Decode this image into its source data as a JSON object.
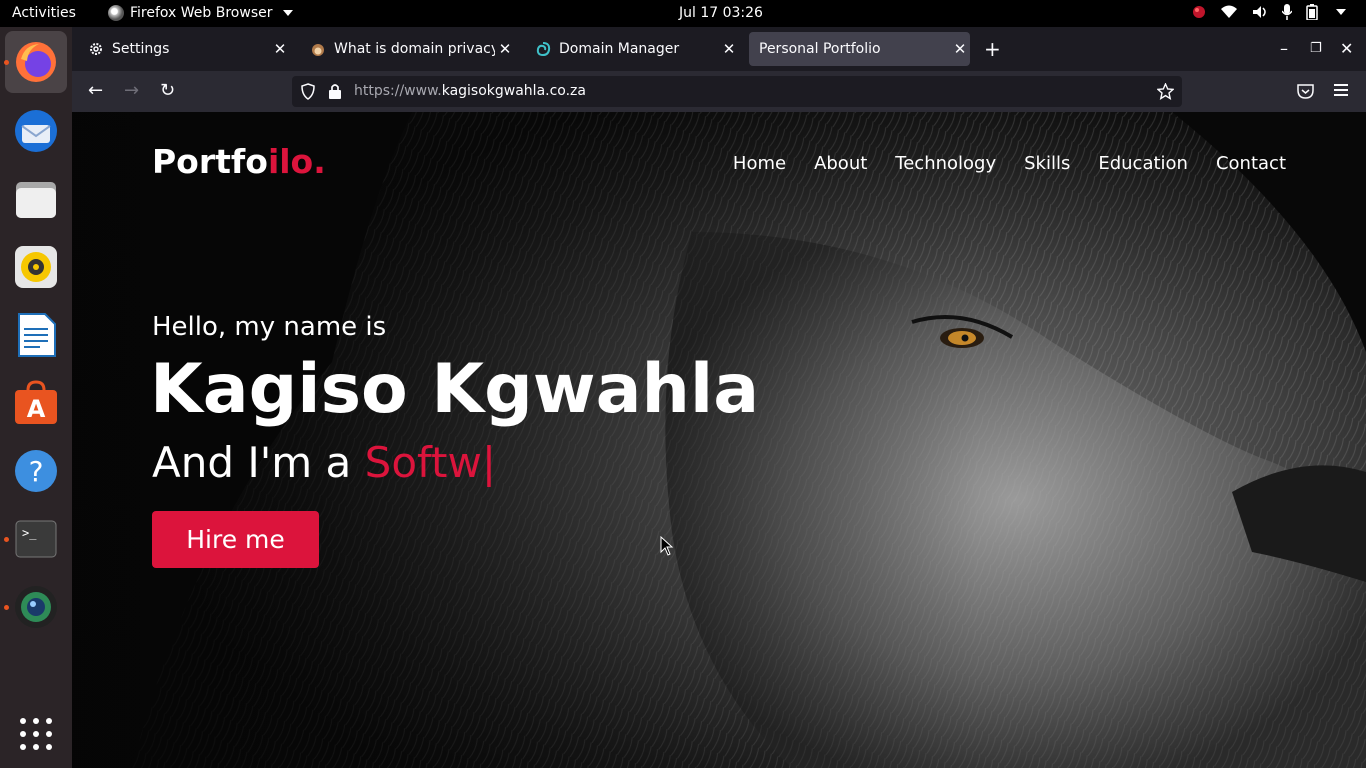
{
  "system": {
    "activities": "Activities",
    "app_menu": "Firefox Web Browser",
    "clock": "Jul 17  03:26"
  },
  "browser": {
    "tabs": [
      {
        "title": "Settings",
        "icon": "gear-icon"
      },
      {
        "title": "What is domain privacy and",
        "icon": "hedgehog-icon"
      },
      {
        "title": "Domain Manager",
        "icon": "swirl-icon"
      },
      {
        "title": "Personal Portfolio",
        "icon": "none",
        "selected": true
      }
    ],
    "url_prefix": "https://www.",
    "url_domain": "kagisokgwahla.co.za"
  },
  "page": {
    "logo_main": "Portfo",
    "logo_accent": "ilo.",
    "menu": [
      "Home",
      "About",
      "Technology",
      "Skills",
      "Education",
      "Contact"
    ],
    "hello": "Hello, my name is",
    "name": "Kagiso Kgwahla",
    "role_prefix": "And I'm a ",
    "role_typed": "Softw|",
    "hire_label": "Hire me",
    "accent_color": "#dc143c"
  },
  "dock": [
    "firefox",
    "thunderbird",
    "files",
    "rhythmbox",
    "writer",
    "software",
    "help",
    "terminal",
    "camera",
    "app-grid"
  ]
}
